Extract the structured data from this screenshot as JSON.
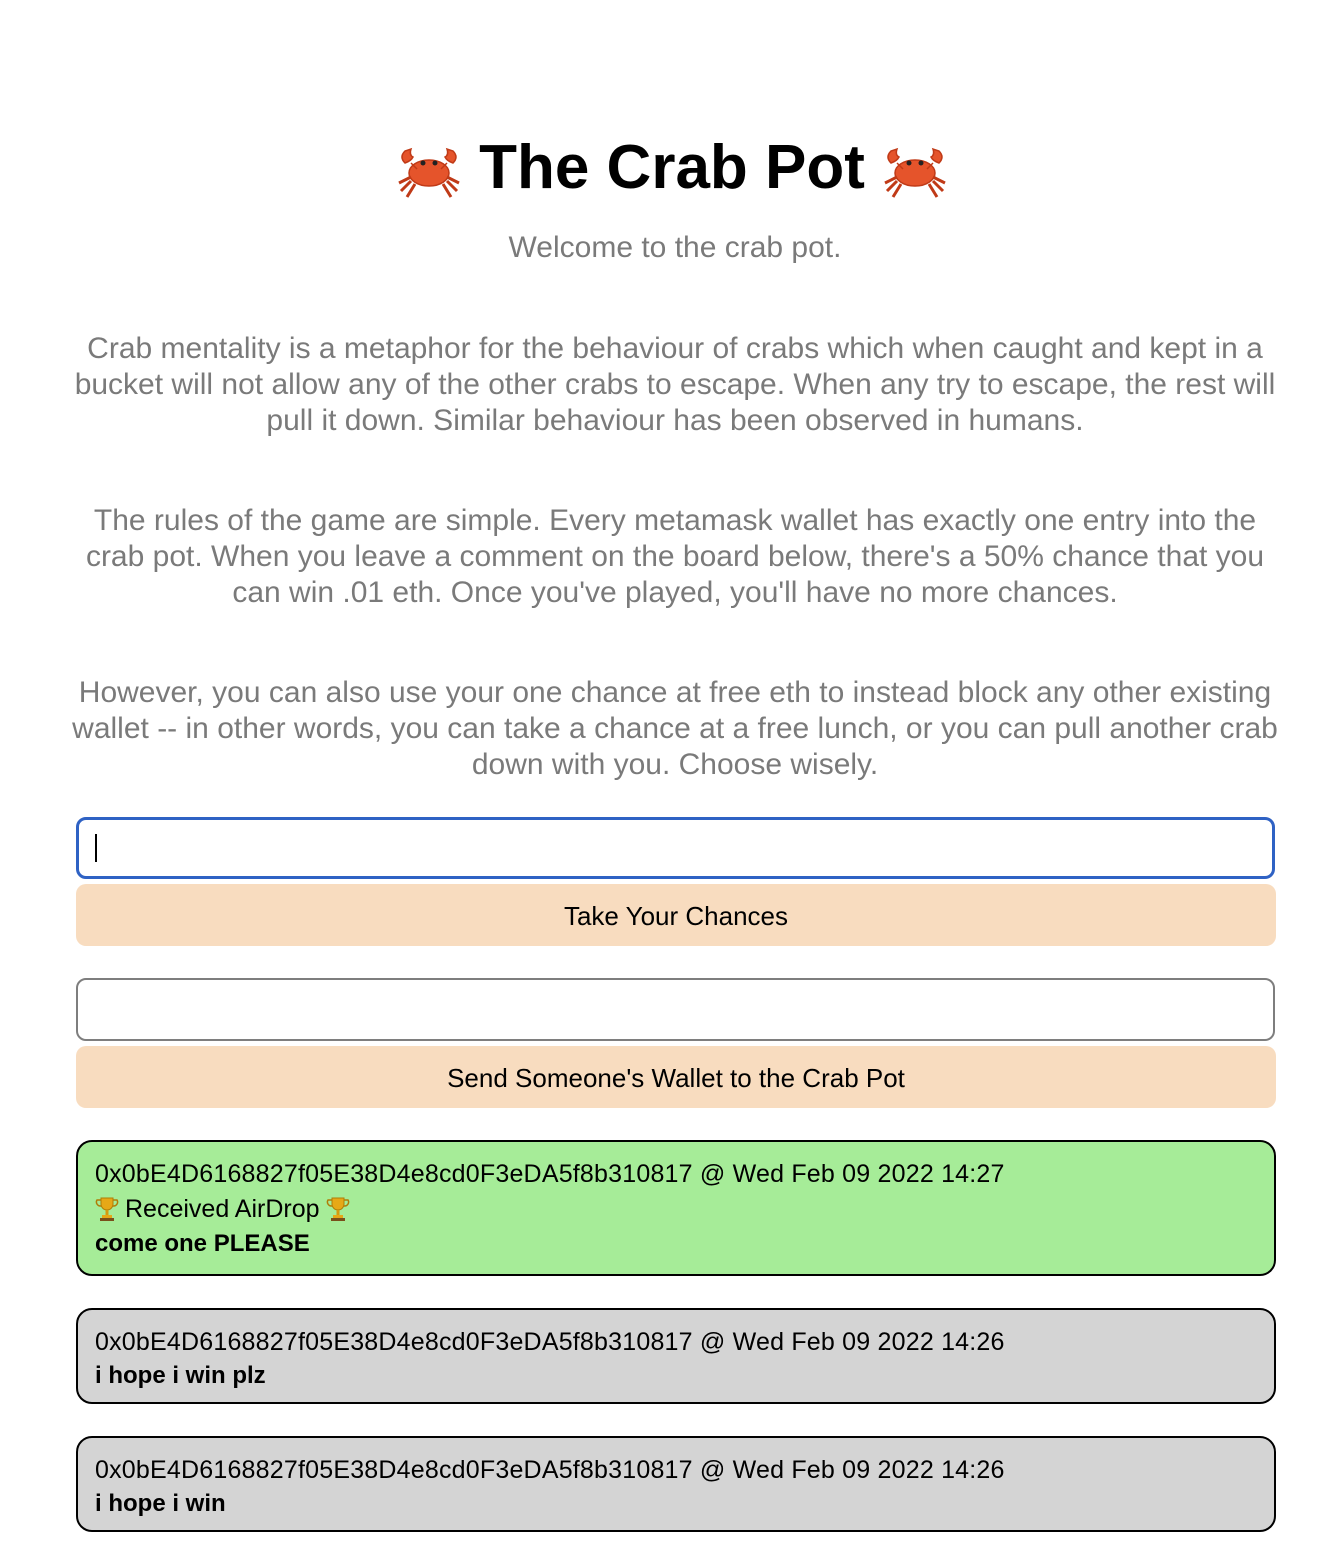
{
  "header": {
    "title": "The Crab Pot",
    "left_icon": "crab-icon",
    "right_icon": "crab-icon"
  },
  "intro": {
    "welcome": "Welcome to the crab pot.",
    "mentality": "Crab mentality is a metaphor for the behaviour of crabs which when caught and kept in a bucket will not allow any of the other crabs to escape. When any try to escape, the rest will pull it down. Similar behaviour has been observed in humans.",
    "rules": "The rules of the game are simple. Every metamask wallet has exactly one entry into the crab pot. When you leave a comment on the board below, there's a 50% chance that you can win .01 eth. Once you've played, you'll have no more chances.",
    "block": "However, you can also use your one chance at free eth to instead block any other existing wallet -- in other words, you can take a chance at a free lunch, or you can pull another crab down with you. Choose wisely."
  },
  "comment_form": {
    "value": "",
    "placeholder": "",
    "button_label": "Take Your Chances"
  },
  "block_form": {
    "value": "",
    "placeholder": "",
    "button_label": "Send Someone's Wallet to the Crab Pot"
  },
  "board": {
    "entries": [
      {
        "meta": "0x0bE4D6168827f05E38D4e8cd0F3eDA5f8b310817 @ Wed Feb 09 2022 14:27",
        "status": "Received AirDrop",
        "status_icon": "trophy-icon",
        "message": "come one PLEASE",
        "color": "#a6ec98"
      },
      {
        "meta": "0x0bE4D6168827f05E38D4e8cd0F3eDA5f8b310817 @ Wed Feb 09 2022 14:26",
        "message": "i hope i win plz",
        "color": "#d4d4d4"
      },
      {
        "meta": "0x0bE4D6168827f05E38D4e8cd0F3eDA5f8b310817 @ Wed Feb 09 2022 14:26",
        "message": "i hope i win",
        "color": "#d4d4d4"
      }
    ]
  },
  "colors": {
    "accent_focus": "#2f62c4",
    "button_bg": "#f8dcbf",
    "winner_bg": "#a6ec98",
    "entry_bg": "#d4d4d4",
    "muted_text": "#7a7a7a"
  }
}
